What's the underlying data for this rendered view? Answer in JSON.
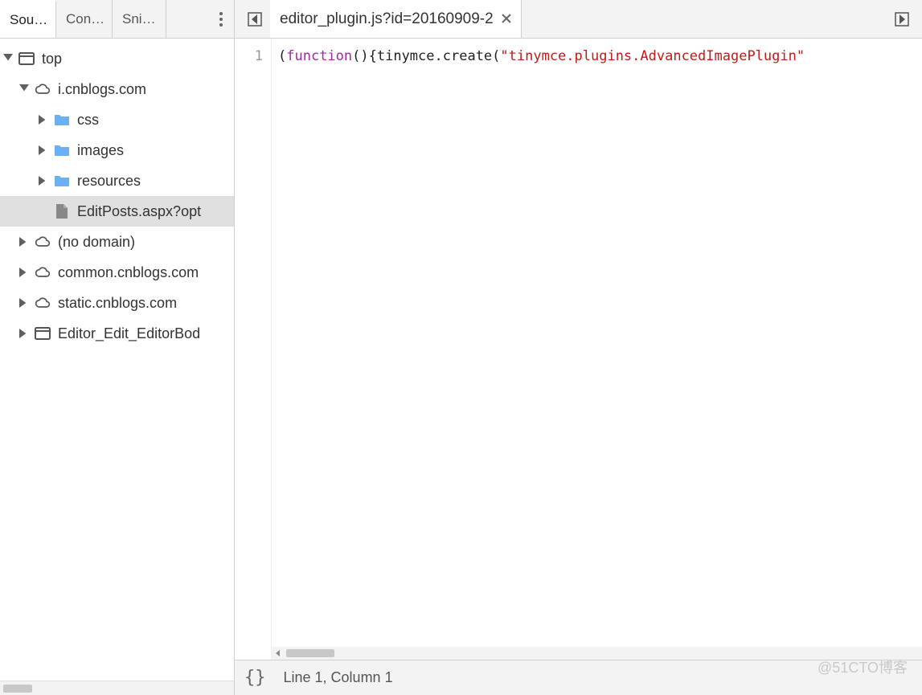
{
  "panel_tabs": {
    "items": [
      "Sou…",
      "Con…",
      "Sni…"
    ],
    "active": 0
  },
  "tree": {
    "top_label": "top",
    "domain_open": "i.cnblogs.com",
    "folders": [
      "css",
      "images",
      "resources"
    ],
    "selected_file": "EditPosts.aspx?opt",
    "collapsed": [
      "(no domain)",
      "common.cnblogs.com",
      "static.cnblogs.com",
      "Editor_Edit_EditorBod"
    ]
  },
  "editor": {
    "tab_title": "editor_plugin.js?id=20160909-2",
    "line_number": "1",
    "code": {
      "p1": "(",
      "kw": "function",
      "p2": "(){",
      "id1": "tinymce",
      "p3": ".create(",
      "str": "\"tinymce.plugins.AdvancedImagePlugin\""
    }
  },
  "status": {
    "braces": "{}",
    "cursor": "Line 1, Column 1"
  },
  "watermark": "@51CTO博客"
}
